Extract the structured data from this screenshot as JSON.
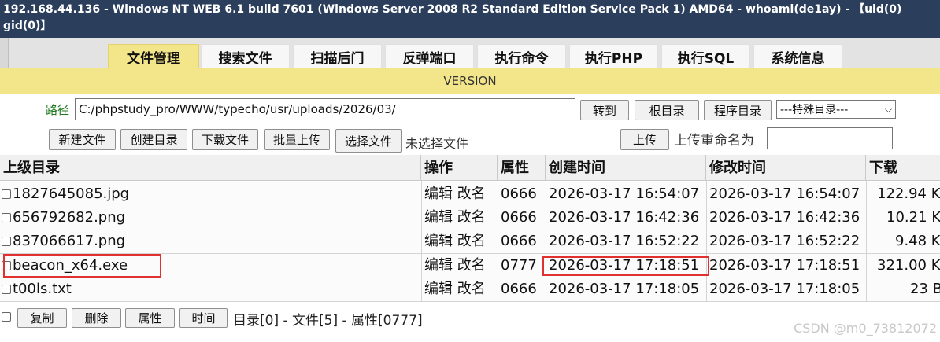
{
  "title": {
    "line1": "192.168.44.136 - Windows NT WEB 6.1 build 7601 (Windows Server 2008 R2 Standard Edition Service Pack 1) AMD64 - whoami(de1ay) - 【uid(0)",
    "line2": "gid(0)】"
  },
  "tabs": [
    "文件管理",
    "搜索文件",
    "扫描后门",
    "反弹端口",
    "执行命令",
    "执行PHP",
    "执行SQL",
    "系统信息"
  ],
  "version_label": "VERSION",
  "path": {
    "label": "路径",
    "value": "C:/phpstudy_pro/WWW/typecho/usr/uploads/2026/03/",
    "go_button": "转到",
    "root_button": "根目录",
    "program_button": "程序目录",
    "special_select": "---特殊目录---"
  },
  "toolbar": {
    "new_file": "新建文件",
    "create_dir": "创建目录",
    "download_file": "下载文件",
    "batch_upload": "批量上传",
    "choose_file": "选择文件",
    "no_file_chosen": "未选择文件",
    "upload": "上传",
    "rename_label": "上传重命名为",
    "rename_value": ""
  },
  "table": {
    "headers": [
      "上级目录",
      "操作",
      "属性",
      "创建时间",
      "修改时间",
      "下载"
    ],
    "rows": [
      {
        "name": "1827645085.jpg",
        "actions": "编辑 改名",
        "perm": "0666",
        "created": "2026-03-17 16:54:07",
        "modified": "2026-03-17 16:54:07",
        "size": "122.94 K"
      },
      {
        "name": "656792682.png",
        "actions": "编辑 改名",
        "perm": "0666",
        "created": "2026-03-17 16:42:36",
        "modified": "2026-03-17 16:42:36",
        "size": "10.21 K"
      },
      {
        "name": "837066617.png",
        "actions": "编辑 改名",
        "perm": "0666",
        "created": "2026-03-17 16:52:22",
        "modified": "2026-03-17 16:52:22",
        "size": "9.48 K"
      },
      {
        "name": "beacon_x64.exe",
        "actions": "编辑 改名",
        "perm": "0777",
        "created": "2026-03-17 17:18:51",
        "modified": "2026-03-17 17:18:51",
        "size": "321.00 K"
      },
      {
        "name": "t00ls.txt",
        "actions": "编辑 改名",
        "perm": "0666",
        "created": "2026-03-17 17:18:05",
        "modified": "2026-03-17 17:18:05",
        "size": "23 B"
      }
    ]
  },
  "footer": {
    "copy": "复制",
    "delete": "删除",
    "attr": "属性",
    "time": "时间",
    "summary": "目录[0] - 文件[5] - 属性[0777]"
  },
  "watermark": "CSDN @m0_73812072",
  "colors": {
    "title_bg": "#2b3e5c",
    "tab_active": "#f3e58a",
    "path_label": "#1f7a1f",
    "highlight": "#e03030"
  }
}
